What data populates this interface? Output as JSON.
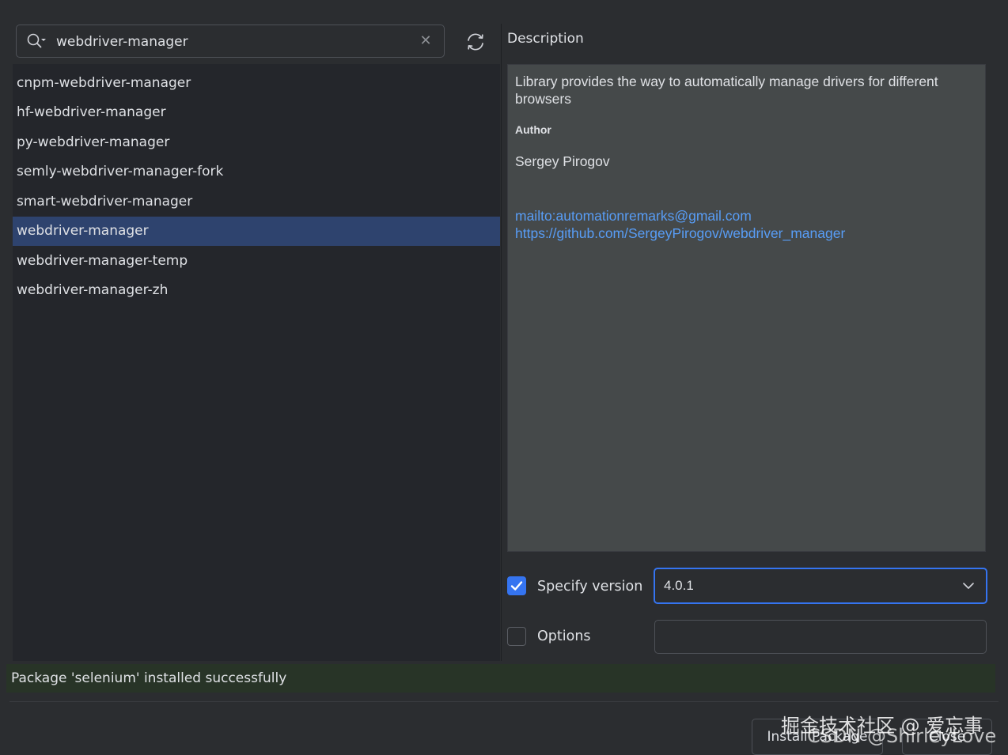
{
  "search": {
    "value": "webdriver-manager"
  },
  "packages": [
    "cnpm-webdriver-manager",
    "hf-webdriver-manager",
    "py-webdriver-manager",
    "semly-webdriver-manager-fork",
    "smart-webdriver-manager",
    "webdriver-manager",
    "webdriver-manager-temp",
    "webdriver-manager-zh"
  ],
  "selected_package": "webdriver-manager",
  "description": {
    "label": "Description",
    "summary": "Library provides the way to automatically manage drivers for different browsers",
    "author_heading": "Author",
    "author_name": "Sergey Pirogov",
    "links": [
      "mailto:automationremarks@gmail.com",
      "https://github.com/SergeyPirogov/webdriver_manager"
    ]
  },
  "version": {
    "specify_label": "Specify version",
    "specify_checked": true,
    "value": "4.0.1"
  },
  "options": {
    "label": "Options",
    "checked": false,
    "value": ""
  },
  "status": {
    "text": "Package 'selenium' installed successfully"
  },
  "buttons": {
    "install_label": "Install Package",
    "close_label": "Close"
  },
  "watermark": {
    "line1": "掘金技术社区 @ 爱忘事",
    "line2": "CSDN @ShirleyLove"
  },
  "icons": {
    "search": "search-icon",
    "clear": "close-icon",
    "refresh": "refresh-icon",
    "dropdown": "chevron-down-icon",
    "check": "checkmark-icon"
  },
  "colors": {
    "background": "#2b2d30",
    "list_background": "#24262b",
    "selection": "#2e436e",
    "accent": "#3574f0",
    "link": "#589df6",
    "description_background": "#45494a",
    "status_background": "#283427"
  }
}
